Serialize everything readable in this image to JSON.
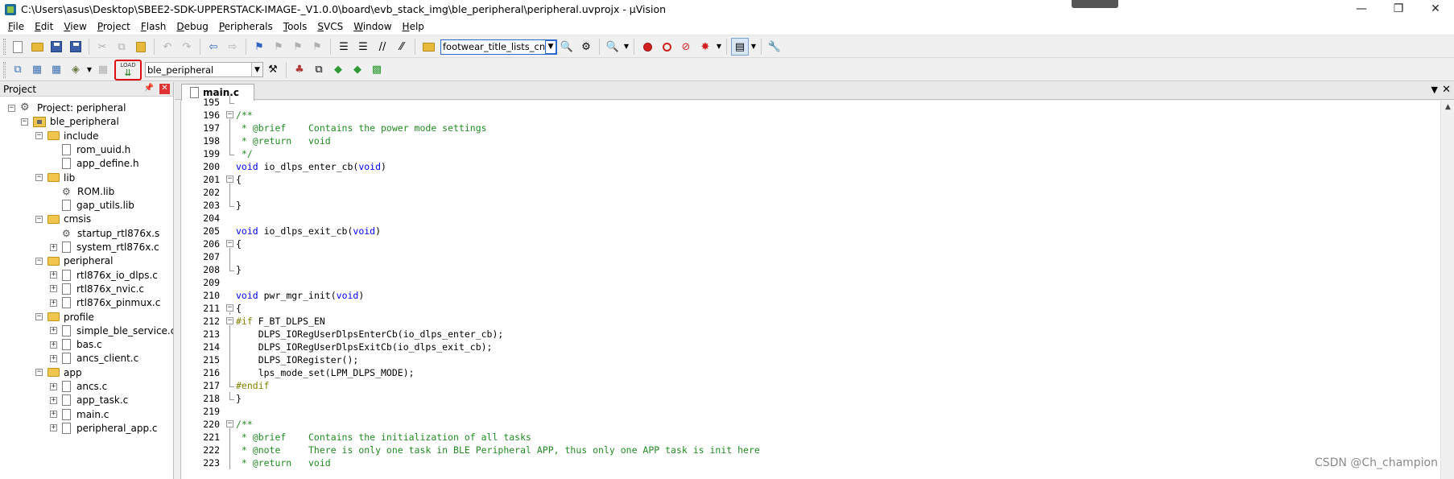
{
  "window": {
    "title": "C:\\Users\\asus\\Desktop\\SBEE2-SDK-UPPERSTACK-IMAGE-_V1.0.0\\board\\evb_stack_img\\ble_peripheral\\peripheral.uvprojx - µVision",
    "minimize": "—",
    "restore": "❐",
    "close": "✕"
  },
  "menu": [
    "File",
    "Edit",
    "View",
    "Project",
    "Flash",
    "Debug",
    "Peripherals",
    "Tools",
    "SVCS",
    "Window",
    "Help"
  ],
  "toolbar": {
    "find_value": "footwear_title_lists_cn",
    "target_value": "ble_peripheral",
    "load_label": "LOAD"
  },
  "project_panel": {
    "title": "Project",
    "pin": "📌",
    "close": "✕",
    "tree": [
      {
        "label": "Project: peripheral",
        "level": 0,
        "kind": "project",
        "exp": "−"
      },
      {
        "label": "ble_peripheral",
        "level": 1,
        "kind": "target",
        "exp": "−"
      },
      {
        "label": "include",
        "level": 2,
        "kind": "folder",
        "exp": "−"
      },
      {
        "label": "rom_uuid.h",
        "level": 3,
        "kind": "file",
        "exp": ""
      },
      {
        "label": "app_define.h",
        "level": 3,
        "kind": "file",
        "exp": ""
      },
      {
        "label": "lib",
        "level": 2,
        "kind": "folder",
        "exp": "−"
      },
      {
        "label": "ROM.lib",
        "level": 3,
        "kind": "lib",
        "exp": ""
      },
      {
        "label": "gap_utils.lib",
        "level": 3,
        "kind": "file",
        "exp": ""
      },
      {
        "label": "cmsis",
        "level": 2,
        "kind": "folder",
        "exp": "−"
      },
      {
        "label": "startup_rtl876x.s",
        "level": 3,
        "kind": "lib",
        "exp": ""
      },
      {
        "label": "system_rtl876x.c",
        "level": 3,
        "kind": "file",
        "exp": "+"
      },
      {
        "label": "peripheral",
        "level": 2,
        "kind": "folder",
        "exp": "−"
      },
      {
        "label": "rtl876x_io_dlps.c",
        "level": 3,
        "kind": "file",
        "exp": "+"
      },
      {
        "label": "rtl876x_nvic.c",
        "level": 3,
        "kind": "file",
        "exp": "+"
      },
      {
        "label": "rtl876x_pinmux.c",
        "level": 3,
        "kind": "file",
        "exp": "+"
      },
      {
        "label": "profile",
        "level": 2,
        "kind": "folder",
        "exp": "−"
      },
      {
        "label": "simple_ble_service.c",
        "level": 3,
        "kind": "file",
        "exp": "+"
      },
      {
        "label": "bas.c",
        "level": 3,
        "kind": "file",
        "exp": "+"
      },
      {
        "label": "ancs_client.c",
        "level": 3,
        "kind": "file",
        "exp": "+"
      },
      {
        "label": "app",
        "level": 2,
        "kind": "folder",
        "exp": "−"
      },
      {
        "label": "ancs.c",
        "level": 3,
        "kind": "file",
        "exp": "+"
      },
      {
        "label": "app_task.c",
        "level": 3,
        "kind": "file",
        "exp": "+"
      },
      {
        "label": "main.c",
        "level": 3,
        "kind": "file",
        "exp": "+"
      },
      {
        "label": "peripheral_app.c",
        "level": 3,
        "kind": "file",
        "exp": "+"
      }
    ]
  },
  "editor": {
    "tab_label": "main.c",
    "tab_dropdown": "▼",
    "tab_close": "✕",
    "lines": [
      {
        "n": "195",
        "t": [
          {
            "c": "n",
            "s": ""
          }
        ],
        "f": "end"
      },
      {
        "n": "196",
        "t": [
          {
            "c": "cm",
            "s": "/**"
          }
        ],
        "f": "box"
      },
      {
        "n": "197",
        "t": [
          {
            "c": "cm",
            "s": " * @brief    Contains the power mode settings"
          }
        ],
        "f": "line"
      },
      {
        "n": "198",
        "t": [
          {
            "c": "cm",
            "s": " * @return   void"
          }
        ],
        "f": "line"
      },
      {
        "n": "199",
        "t": [
          {
            "c": "cm",
            "s": " */"
          }
        ],
        "f": "end"
      },
      {
        "n": "200",
        "t": [
          {
            "c": "kw",
            "s": "void"
          },
          {
            "c": "n",
            "s": " io_dlps_enter_cb("
          },
          {
            "c": "kw",
            "s": "void"
          },
          {
            "c": "n",
            "s": ")"
          }
        ],
        "f": ""
      },
      {
        "n": "201",
        "t": [
          {
            "c": "n",
            "s": "{"
          }
        ],
        "f": "box"
      },
      {
        "n": "202",
        "t": [
          {
            "c": "n",
            "s": ""
          }
        ],
        "f": "line"
      },
      {
        "n": "203",
        "t": [
          {
            "c": "n",
            "s": "}"
          }
        ],
        "f": "end"
      },
      {
        "n": "204",
        "t": [
          {
            "c": "n",
            "s": ""
          }
        ],
        "f": ""
      },
      {
        "n": "205",
        "t": [
          {
            "c": "kw",
            "s": "void"
          },
          {
            "c": "n",
            "s": " io_dlps_exit_cb("
          },
          {
            "c": "kw",
            "s": "void"
          },
          {
            "c": "n",
            "s": ")"
          }
        ],
        "f": ""
      },
      {
        "n": "206",
        "t": [
          {
            "c": "n",
            "s": "{"
          }
        ],
        "f": "box"
      },
      {
        "n": "207",
        "t": [
          {
            "c": "n",
            "s": ""
          }
        ],
        "f": "line"
      },
      {
        "n": "208",
        "t": [
          {
            "c": "n",
            "s": "}"
          }
        ],
        "f": "end"
      },
      {
        "n": "209",
        "t": [
          {
            "c": "n",
            "s": ""
          }
        ],
        "f": ""
      },
      {
        "n": "210",
        "t": [
          {
            "c": "kw",
            "s": "void"
          },
          {
            "c": "n",
            "s": " pwr_mgr_init("
          },
          {
            "c": "kw",
            "s": "void"
          },
          {
            "c": "n",
            "s": ")"
          }
        ],
        "f": ""
      },
      {
        "n": "211",
        "t": [
          {
            "c": "n",
            "s": "{"
          }
        ],
        "f": "box"
      },
      {
        "n": "212",
        "t": [
          {
            "c": "pp",
            "s": "#if"
          },
          {
            "c": "n",
            "s": " F_BT_DLPS_EN"
          }
        ],
        "f": "box"
      },
      {
        "n": "213",
        "t": [
          {
            "c": "n",
            "s": "    DLPS_IORegUserDlpsEnterCb(io_dlps_enter_cb);"
          }
        ],
        "f": "line"
      },
      {
        "n": "214",
        "t": [
          {
            "c": "n",
            "s": "    DLPS_IORegUserDlpsExitCb(io_dlps_exit_cb);"
          }
        ],
        "f": "line"
      },
      {
        "n": "215",
        "t": [
          {
            "c": "n",
            "s": "    DLPS_IORegister();"
          }
        ],
        "f": "line"
      },
      {
        "n": "216",
        "t": [
          {
            "c": "n",
            "s": "    lps_mode_set(LPM_DLPS_MODE);"
          }
        ],
        "f": "line"
      },
      {
        "n": "217",
        "t": [
          {
            "c": "pp",
            "s": "#endif"
          }
        ],
        "f": "end"
      },
      {
        "n": "218",
        "t": [
          {
            "c": "n",
            "s": "}"
          }
        ],
        "f": "end"
      },
      {
        "n": "219",
        "t": [
          {
            "c": "n",
            "s": ""
          }
        ],
        "f": ""
      },
      {
        "n": "220",
        "t": [
          {
            "c": "cm",
            "s": "/**"
          }
        ],
        "f": "box"
      },
      {
        "n": "221",
        "t": [
          {
            "c": "cm",
            "s": " * @brief    Contains the initialization of all tasks"
          }
        ],
        "f": "line"
      },
      {
        "n": "222",
        "t": [
          {
            "c": "cm",
            "s": " * @note     There is only one task in BLE Peripheral APP, thus only one APP task is init here"
          }
        ],
        "f": "line"
      },
      {
        "n": "223",
        "t": [
          {
            "c": "cm",
            "s": " * @return   void"
          }
        ],
        "f": "line"
      }
    ]
  },
  "watermark": "CSDN @Ch_champion"
}
